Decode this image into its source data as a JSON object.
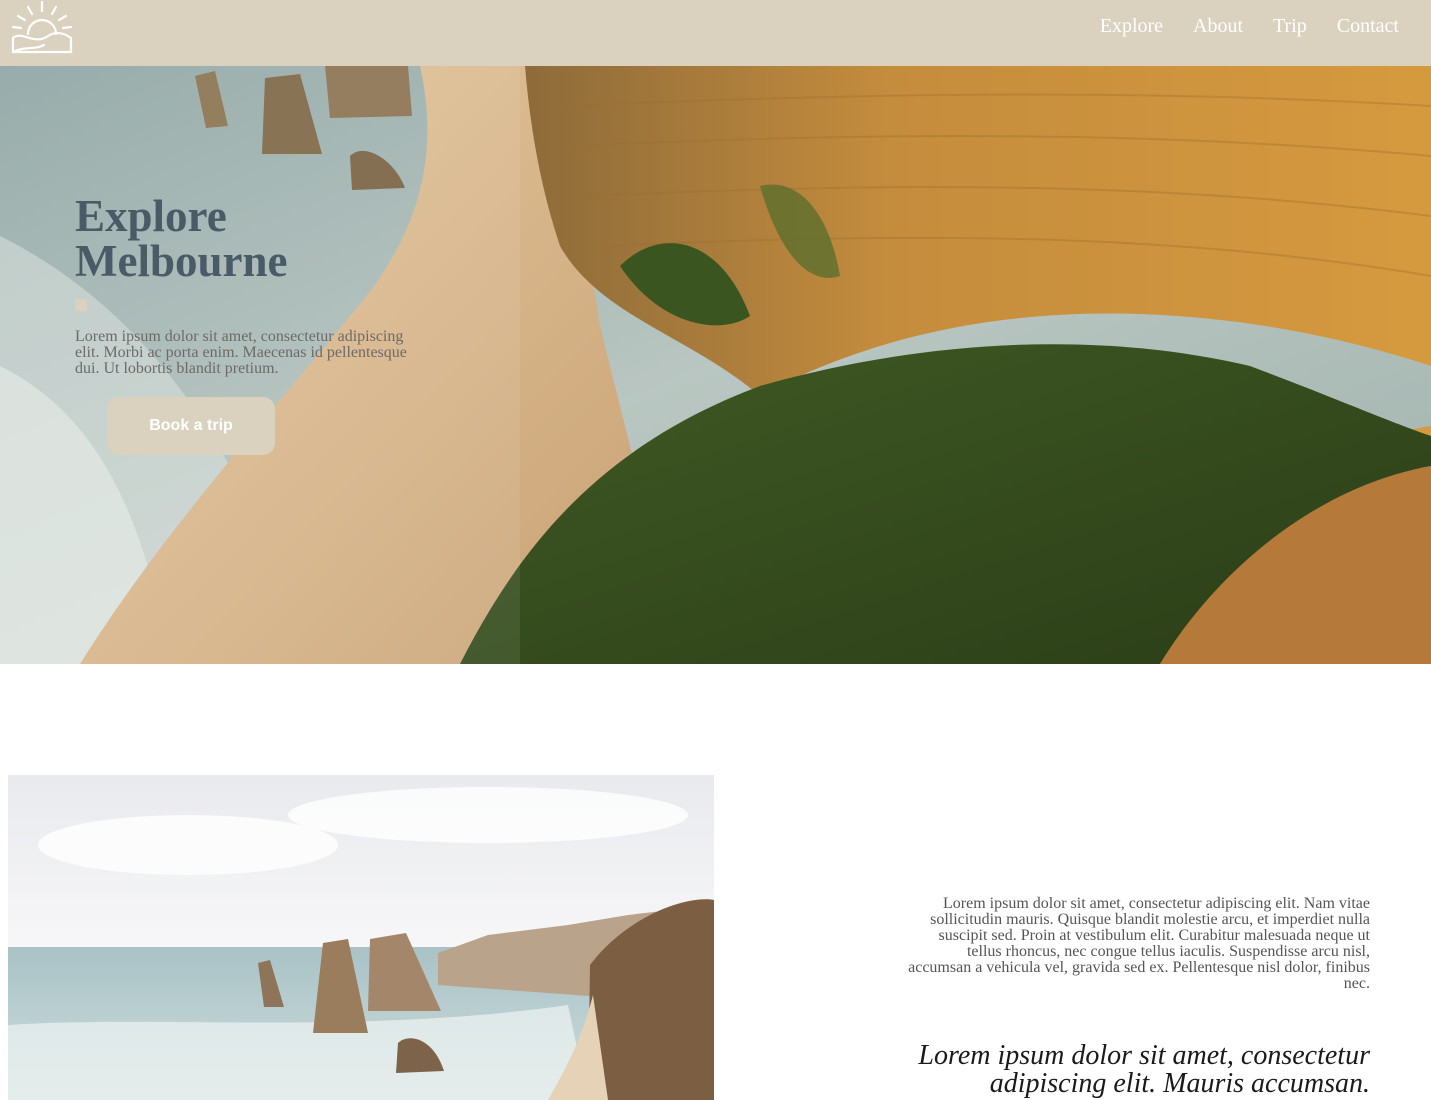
{
  "header": {
    "logo_icon": "sunrise-logo-icon",
    "nav": [
      {
        "label": "Explore"
      },
      {
        "label": "About"
      },
      {
        "label": "Trip"
      },
      {
        "label": "Contact"
      }
    ]
  },
  "hero": {
    "title": "Explore Melbourne",
    "text": "Lorem ipsum dolor sit amet, consectetur adipiscing elit. Morbi ac porta enim. Maecenas id pellentesque dui. Ut lobortis blandit pretium.",
    "button_label": "Book a trip"
  },
  "section": {
    "text": "Lorem ipsum dolor sit amet, consectetur adipiscing elit. Nam vitae sollicitudin mauris. Quisque blandit molestie arcu, et imperdiet nulla suscipit sed. Proin at vestibulum elit. Curabitur malesuada neque ut tellus rhoncus, nec congue tellus iaculis. Suspendisse arcu nisl, accumsan a vehicula vel, gravida sed ex. Pellentesque nisl dolor, finibus nec.",
    "quote": "Lorem ipsum dolor sit amet, consectetur adipiscing elit. Mauris accumsan."
  },
  "colors": {
    "header_bg": "#dbd1bf",
    "title": "#4a5a66",
    "button_bg": "#dbd1bf"
  }
}
